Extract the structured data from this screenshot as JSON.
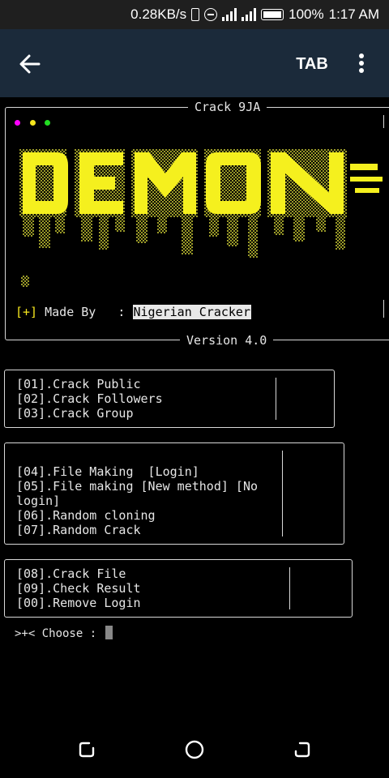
{
  "status": {
    "speed": "0.28KB/s",
    "battery": "100%",
    "time": "1:17 AM"
  },
  "appbar": {
    "tab_label": "TAB"
  },
  "banner": {
    "title": "Crack 9JA",
    "made_by_prefix": "[+]",
    "made_by_label": " Made By   : ",
    "made_by_value": "Nigerian Cracker",
    "version": "Version 4.0",
    "dot_colors": [
      "#ff00ff",
      "#f5e61e",
      "#22dd22"
    ],
    "art_color": "#f5f01e",
    "art_text": "DEMON"
  },
  "menu_groups": [
    {
      "lines": [
        "[01].Crack Public",
        "[02].Crack Followers",
        "[03].Crack Group"
      ]
    },
    {
      "lines": [
        "[04].File Making  [Login]",
        "[05].File making [New method] [No",
        "login]",
        "[06].Random cloning",
        "[07].Random Crack"
      ]
    },
    {
      "lines": [
        "[08].Crack File",
        "[09].Check Result",
        "[00].Remove Login"
      ]
    }
  ],
  "prompt": {
    "label": ">+< Choose : "
  }
}
